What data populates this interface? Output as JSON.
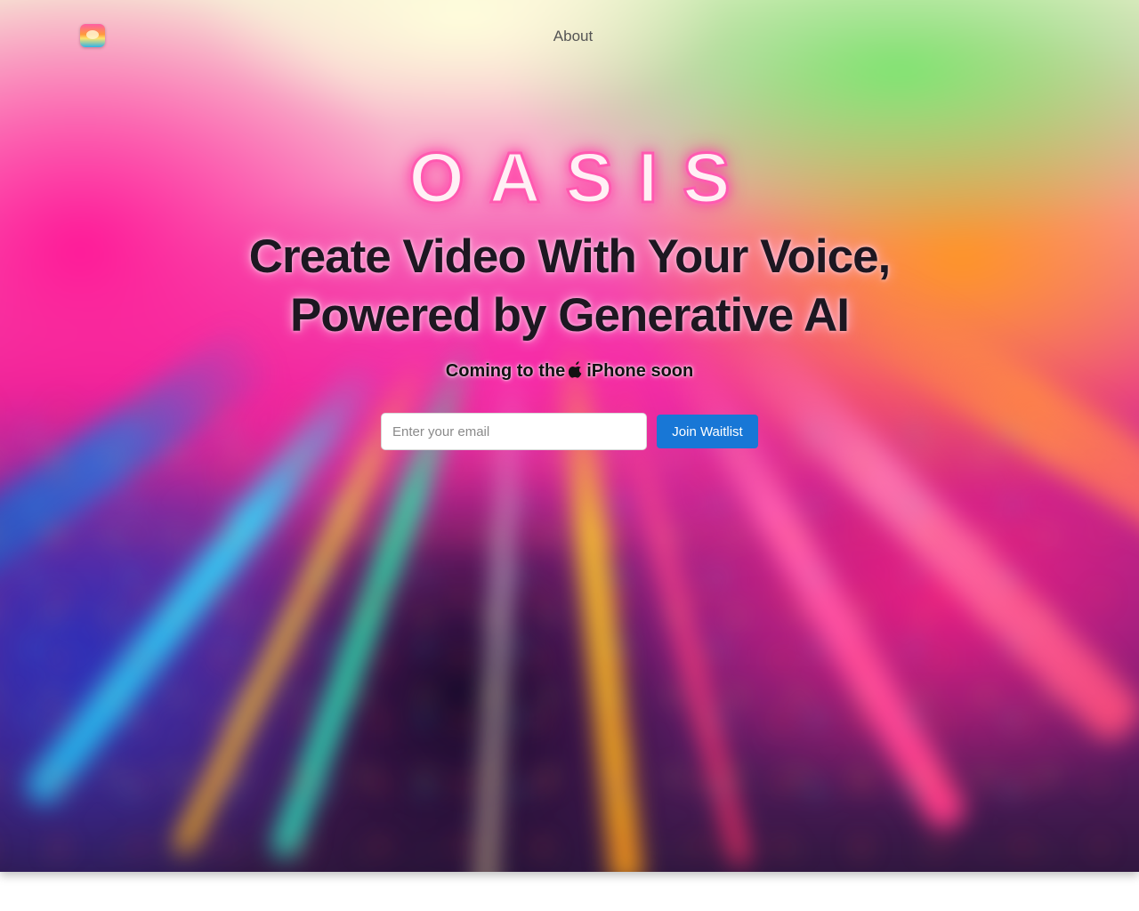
{
  "nav": {
    "about_label": "About",
    "logo_icon": "oasis-sunset-logo-icon"
  },
  "hero": {
    "brand": "OASIS",
    "headline_line1": "Create Video With Your Voice,",
    "headline_line2": "Powered by Generative AI",
    "tagline_before": "Coming to the",
    "tagline_icon": "apple-icon",
    "tagline_after": "iPhone soon"
  },
  "signup": {
    "email_placeholder": "Enter your email",
    "email_value": "",
    "button_label": "Join Waitlist"
  },
  "colors": {
    "button_bg": "#1877d6",
    "brand_glow": "#ff5ab0",
    "headline_text": "#1d1721"
  }
}
